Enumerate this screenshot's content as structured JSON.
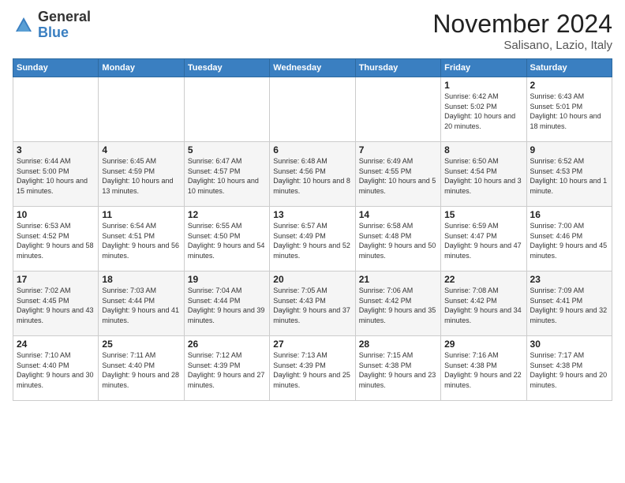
{
  "header": {
    "logo_general": "General",
    "logo_blue": "Blue",
    "month_title": "November 2024",
    "location": "Salisano, Lazio, Italy"
  },
  "days_of_week": [
    "Sunday",
    "Monday",
    "Tuesday",
    "Wednesday",
    "Thursday",
    "Friday",
    "Saturday"
  ],
  "weeks": [
    [
      {
        "day": "",
        "info": ""
      },
      {
        "day": "",
        "info": ""
      },
      {
        "day": "",
        "info": ""
      },
      {
        "day": "",
        "info": ""
      },
      {
        "day": "",
        "info": ""
      },
      {
        "day": "1",
        "info": "Sunrise: 6:42 AM\nSunset: 5:02 PM\nDaylight: 10 hours\nand 20 minutes."
      },
      {
        "day": "2",
        "info": "Sunrise: 6:43 AM\nSunset: 5:01 PM\nDaylight: 10 hours\nand 18 minutes."
      }
    ],
    [
      {
        "day": "3",
        "info": "Sunrise: 6:44 AM\nSunset: 5:00 PM\nDaylight: 10 hours\nand 15 minutes."
      },
      {
        "day": "4",
        "info": "Sunrise: 6:45 AM\nSunset: 4:59 PM\nDaylight: 10 hours\nand 13 minutes."
      },
      {
        "day": "5",
        "info": "Sunrise: 6:47 AM\nSunset: 4:57 PM\nDaylight: 10 hours\nand 10 minutes."
      },
      {
        "day": "6",
        "info": "Sunrise: 6:48 AM\nSunset: 4:56 PM\nDaylight: 10 hours\nand 8 minutes."
      },
      {
        "day": "7",
        "info": "Sunrise: 6:49 AM\nSunset: 4:55 PM\nDaylight: 10 hours\nand 5 minutes."
      },
      {
        "day": "8",
        "info": "Sunrise: 6:50 AM\nSunset: 4:54 PM\nDaylight: 10 hours\nand 3 minutes."
      },
      {
        "day": "9",
        "info": "Sunrise: 6:52 AM\nSunset: 4:53 PM\nDaylight: 10 hours\nand 1 minute."
      }
    ],
    [
      {
        "day": "10",
        "info": "Sunrise: 6:53 AM\nSunset: 4:52 PM\nDaylight: 9 hours\nand 58 minutes."
      },
      {
        "day": "11",
        "info": "Sunrise: 6:54 AM\nSunset: 4:51 PM\nDaylight: 9 hours\nand 56 minutes."
      },
      {
        "day": "12",
        "info": "Sunrise: 6:55 AM\nSunset: 4:50 PM\nDaylight: 9 hours\nand 54 minutes."
      },
      {
        "day": "13",
        "info": "Sunrise: 6:57 AM\nSunset: 4:49 PM\nDaylight: 9 hours\nand 52 minutes."
      },
      {
        "day": "14",
        "info": "Sunrise: 6:58 AM\nSunset: 4:48 PM\nDaylight: 9 hours\nand 50 minutes."
      },
      {
        "day": "15",
        "info": "Sunrise: 6:59 AM\nSunset: 4:47 PM\nDaylight: 9 hours\nand 47 minutes."
      },
      {
        "day": "16",
        "info": "Sunrise: 7:00 AM\nSunset: 4:46 PM\nDaylight: 9 hours\nand 45 minutes."
      }
    ],
    [
      {
        "day": "17",
        "info": "Sunrise: 7:02 AM\nSunset: 4:45 PM\nDaylight: 9 hours\nand 43 minutes."
      },
      {
        "day": "18",
        "info": "Sunrise: 7:03 AM\nSunset: 4:44 PM\nDaylight: 9 hours\nand 41 minutes."
      },
      {
        "day": "19",
        "info": "Sunrise: 7:04 AM\nSunset: 4:44 PM\nDaylight: 9 hours\nand 39 minutes."
      },
      {
        "day": "20",
        "info": "Sunrise: 7:05 AM\nSunset: 4:43 PM\nDaylight: 9 hours\nand 37 minutes."
      },
      {
        "day": "21",
        "info": "Sunrise: 7:06 AM\nSunset: 4:42 PM\nDaylight: 9 hours\nand 35 minutes."
      },
      {
        "day": "22",
        "info": "Sunrise: 7:08 AM\nSunset: 4:42 PM\nDaylight: 9 hours\nand 34 minutes."
      },
      {
        "day": "23",
        "info": "Sunrise: 7:09 AM\nSunset: 4:41 PM\nDaylight: 9 hours\nand 32 minutes."
      }
    ],
    [
      {
        "day": "24",
        "info": "Sunrise: 7:10 AM\nSunset: 4:40 PM\nDaylight: 9 hours\nand 30 minutes."
      },
      {
        "day": "25",
        "info": "Sunrise: 7:11 AM\nSunset: 4:40 PM\nDaylight: 9 hours\nand 28 minutes."
      },
      {
        "day": "26",
        "info": "Sunrise: 7:12 AM\nSunset: 4:39 PM\nDaylight: 9 hours\nand 27 minutes."
      },
      {
        "day": "27",
        "info": "Sunrise: 7:13 AM\nSunset: 4:39 PM\nDaylight: 9 hours\nand 25 minutes."
      },
      {
        "day": "28",
        "info": "Sunrise: 7:15 AM\nSunset: 4:38 PM\nDaylight: 9 hours\nand 23 minutes."
      },
      {
        "day": "29",
        "info": "Sunrise: 7:16 AM\nSunset: 4:38 PM\nDaylight: 9 hours\nand 22 minutes."
      },
      {
        "day": "30",
        "info": "Sunrise: 7:17 AM\nSunset: 4:38 PM\nDaylight: 9 hours\nand 20 minutes."
      }
    ]
  ]
}
